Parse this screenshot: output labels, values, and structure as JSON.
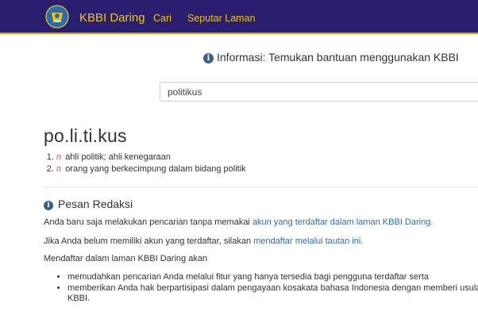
{
  "navbar": {
    "brand": "KBBI Daring",
    "links": [
      "Cari",
      "Seputar Laman"
    ]
  },
  "info": {
    "text": "Informasi: Temukan bantuan menggunakan KBBI"
  },
  "search": {
    "value": "politikus"
  },
  "entry": {
    "headword": "po.li.ti.kus",
    "definitions": [
      {
        "pos": "n",
        "text": "ahli politik; ahli kenegaraan"
      },
      {
        "pos": "n",
        "text": "orang yang berkecimpung dalam bidang politik"
      }
    ]
  },
  "pesan": {
    "title": "Pesan Redaksi",
    "p1_text": "Anda baru saja melakukan pencarian tanpa memakai ",
    "p1_link": "akun yang terdaftar dalam laman KBBI Daring",
    "p1_end": ".",
    "p2_text": "Jika Anda belum memiliki akun yang terdaftar, silakan ",
    "p2_link": "mendaftar melalui tautan ini",
    "p2_end": ".",
    "p3_text": "Mendaftar dalam laman KBBI Daring akan",
    "benefits": [
      "memudahkan pencarian Anda melalui fitur yang hanya tersedia bagi pengguna terdaftar serta",
      "memberikan Anda hak berpartisipasi dalam pengayaan kosakata bahasa Indonesia dengan memberi usulan ke KBBI."
    ]
  },
  "colors": {
    "navbar_bg": "#2a1f6e",
    "navbar_text": "#f1c40f",
    "link": "#2a6db0",
    "pos_label": "#d9534f"
  },
  "icons": {
    "info": "info-circle-icon",
    "logo": "tut-wuri-handayani-logo"
  }
}
